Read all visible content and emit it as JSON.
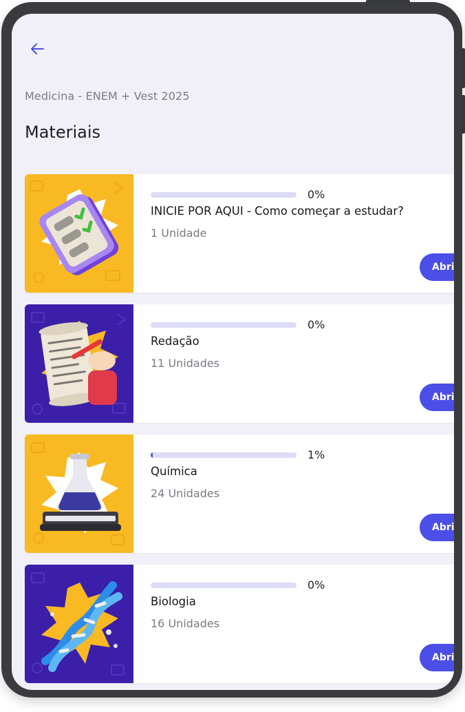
{
  "header": {
    "back_icon": "arrow-left-icon",
    "subtitle": "Medicina - ENEM + Vest 2025",
    "title": "Materiais"
  },
  "colors": {
    "accent": "#4c4ee8",
    "progress_track": "#dcdcf6",
    "thumb_yellow": "#f8b923",
    "thumb_purple": "#3b1fa8"
  },
  "materials": [
    {
      "progress_label": "0%",
      "progress": 0,
      "title": "INICIE POR AQUI - Como começar a estudar?",
      "units": "1 Unidade",
      "button_label": "Abrir",
      "thumb_icon": "checklist-icon"
    },
    {
      "progress_label": "0%",
      "progress": 0,
      "title": "Redação",
      "units": "11 Unidades",
      "button_label": "Abrir",
      "thumb_icon": "writing-scroll-icon"
    },
    {
      "progress_label": "1%",
      "progress": 0.01,
      "title": "Química",
      "units": "24 Unidades",
      "button_label": "Abrir",
      "thumb_icon": "flask-on-book-icon"
    },
    {
      "progress_label": "0%",
      "progress": 0,
      "title": "Biologia",
      "units": "16 Unidades",
      "button_label": "Abrir",
      "thumb_icon": "dna-icon"
    }
  ]
}
